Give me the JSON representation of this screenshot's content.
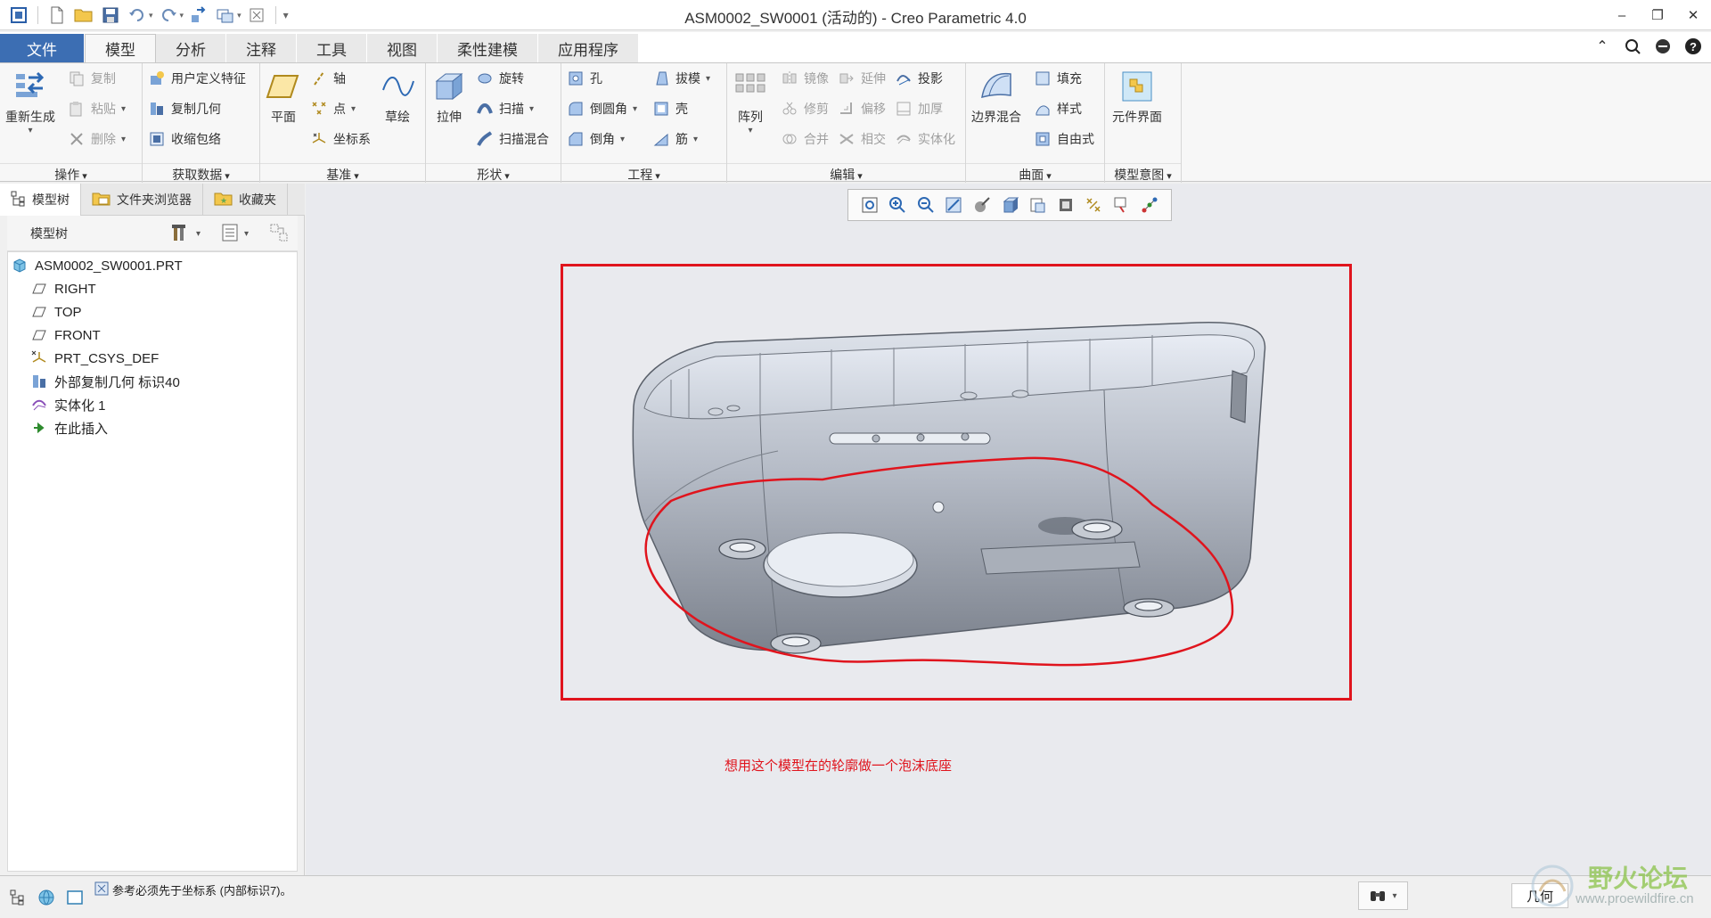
{
  "window": {
    "title": "ASM0002_SW0001 (活动的) - Creo Parametric 4.0",
    "minimize": "–",
    "restore": "❐",
    "close": "✕"
  },
  "ribbon_tabs": [
    "文件",
    "模型",
    "分析",
    "注释",
    "工具",
    "视图",
    "柔性建模",
    "应用程序"
  ],
  "ribbon_groups": {
    "operations": {
      "label": "操作",
      "regenerate": "重新生成",
      "copy": "复制",
      "paste": "粘贴",
      "delete": "删除"
    },
    "get_data": {
      "label": "获取数据",
      "udf": "用户定义特征",
      "copy_geom": "复制几何",
      "shrinkwrap": "收缩包络"
    },
    "datum": {
      "label": "基准",
      "plane": "平面",
      "axis": "轴",
      "point": "点",
      "csys": "坐标系",
      "sketch": "草绘"
    },
    "shapes": {
      "label": "形状",
      "extrude": "拉伸",
      "revolve": "旋转",
      "sweep": "扫描",
      "swept_blend": "扫描混合"
    },
    "engineering": {
      "label": "工程",
      "hole": "孔",
      "round": "倒圆角",
      "chamfer": "倒角",
      "draft": "拔模",
      "shell": "壳",
      "rib": "筋"
    },
    "editing": {
      "label": "编辑",
      "pattern": "阵列",
      "mirror": "镜像",
      "trim": "修剪",
      "merge": "合并",
      "extend": "延伸",
      "offset": "偏移",
      "intersect": "相交",
      "project": "投影",
      "thicken": "加厚",
      "solidify": "实体化"
    },
    "surfaces": {
      "label": "曲面",
      "boundary_blend": "边界混合",
      "fill": "填充",
      "style": "样式",
      "freestyle": "自由式"
    },
    "model_intent": {
      "label": "模型意图",
      "component_interface": "元件界面"
    }
  },
  "left_panel": {
    "tabs": [
      "模型树",
      "文件夹浏览器",
      "收藏夹"
    ],
    "header": "模型树",
    "tree": [
      {
        "label": "ASM0002_SW0001.PRT",
        "icon": "part-icon"
      },
      {
        "label": "RIGHT",
        "icon": "datum-plane-icon"
      },
      {
        "label": "TOP",
        "icon": "datum-plane-icon"
      },
      {
        "label": "FRONT",
        "icon": "datum-plane-icon"
      },
      {
        "label": "PRT_CSYS_DEF",
        "icon": "csys-icon"
      },
      {
        "label": "外部复制几何 标识40",
        "icon": "external-copy-geom-icon"
      },
      {
        "label": "实体化 1",
        "icon": "solidify-icon"
      },
      {
        "label": "在此插入",
        "icon": "insert-here-arrow-icon"
      }
    ]
  },
  "graphics": {
    "annotation": "想用这个模型在的轮廓做一个泡沫底座",
    "annotation_color": "#e0141d"
  },
  "status": {
    "message": "参考必须先于坐标系 (内部标识7)。",
    "filter": "几何"
  },
  "watermark": {
    "title": "野火论坛",
    "url": "www.proewildfire.cn"
  },
  "colors": {
    "file_tab": "#3c6eb3",
    "accent_red": "#e0141d"
  }
}
